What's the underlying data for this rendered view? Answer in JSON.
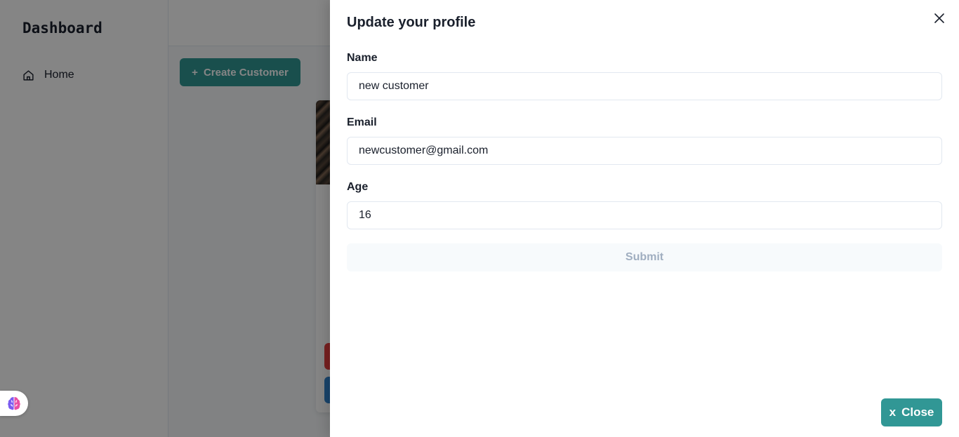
{
  "sidebar": {
    "brand": "Dashboard",
    "items": [
      {
        "label": "Home",
        "icon": "home-icon"
      }
    ]
  },
  "main": {
    "create_button": {
      "prefix": "+",
      "label": "Create Customer"
    }
  },
  "drawer": {
    "title": "Update your profile",
    "fields": {
      "name": {
        "label": "Name",
        "value": "new customer"
      },
      "email": {
        "label": "Email",
        "value": "newcustomer@gmail.com"
      },
      "age": {
        "label": "Age",
        "value": "16"
      }
    },
    "submit_label": "Submit",
    "close_button": {
      "prefix": "x",
      "label": "Close"
    }
  },
  "colors": {
    "accent": "#319795",
    "overlay": "rgba(0,0,0,0.48)",
    "danger": "#e53e3e",
    "info": "#3182ce"
  }
}
